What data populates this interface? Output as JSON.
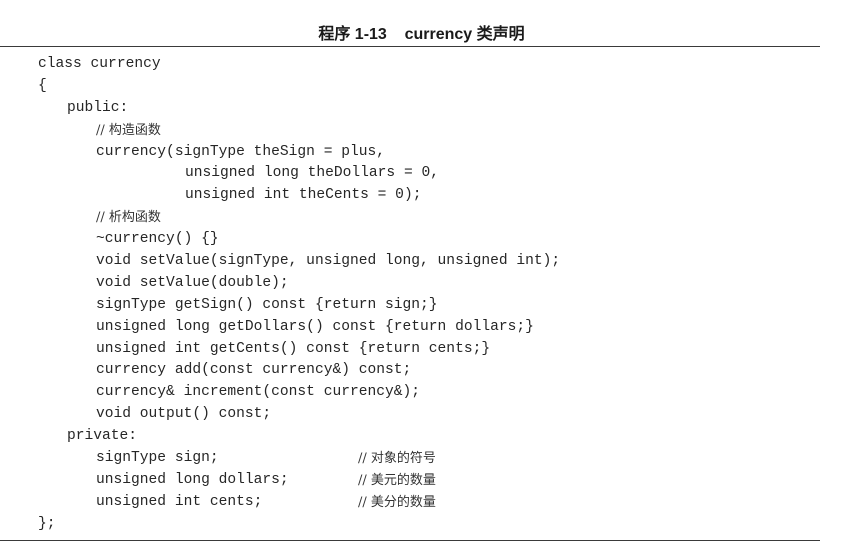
{
  "caption": "程序 1-13    currency 类声明",
  "code_lines": [
    {
      "text": "class currency",
      "indent": 0
    },
    {
      "text": "{",
      "indent": 0
    },
    {
      "text": "public:",
      "indent": 1
    },
    {
      "text": "// 构造函数",
      "indent": 2,
      "is_comment": true
    },
    {
      "text": "currency(signType theSign = plus,",
      "indent": 2
    },
    {
      "text": "unsigned long theDollars = 0,",
      "indent": 5
    },
    {
      "text": "unsigned int theCents = 0);",
      "indent": 5
    },
    {
      "text": "// 析构函数",
      "indent": 2,
      "is_comment": true
    },
    {
      "text": "~currency() {}",
      "indent": 2
    },
    {
      "text": "void setValue(signType, unsigned long, unsigned int);",
      "indent": 2
    },
    {
      "text": "void setValue(double);",
      "indent": 2
    },
    {
      "text": "signType getSign() const {return sign;}",
      "indent": 2
    },
    {
      "text": "unsigned long getDollars() const {return dollars;}",
      "indent": 2
    },
    {
      "text": "unsigned int getCents() const {return cents;}",
      "indent": 2
    },
    {
      "text": "currency add(const currency&) const;",
      "indent": 2
    },
    {
      "text": "currency& increment(const currency&);",
      "indent": 2
    },
    {
      "text": "void output() const;",
      "indent": 2
    },
    {
      "text": "private:",
      "indent": 1
    },
    {
      "text": "signType sign;",
      "indent": 2,
      "comment": "// 对象的符号"
    },
    {
      "text": "unsigned long dollars;",
      "indent": 2,
      "comment": "// 美元的数量"
    },
    {
      "text": "unsigned int cents;",
      "indent": 2,
      "comment": "// 美分的数量"
    },
    {
      "text": "};",
      "indent": 0
    }
  ]
}
